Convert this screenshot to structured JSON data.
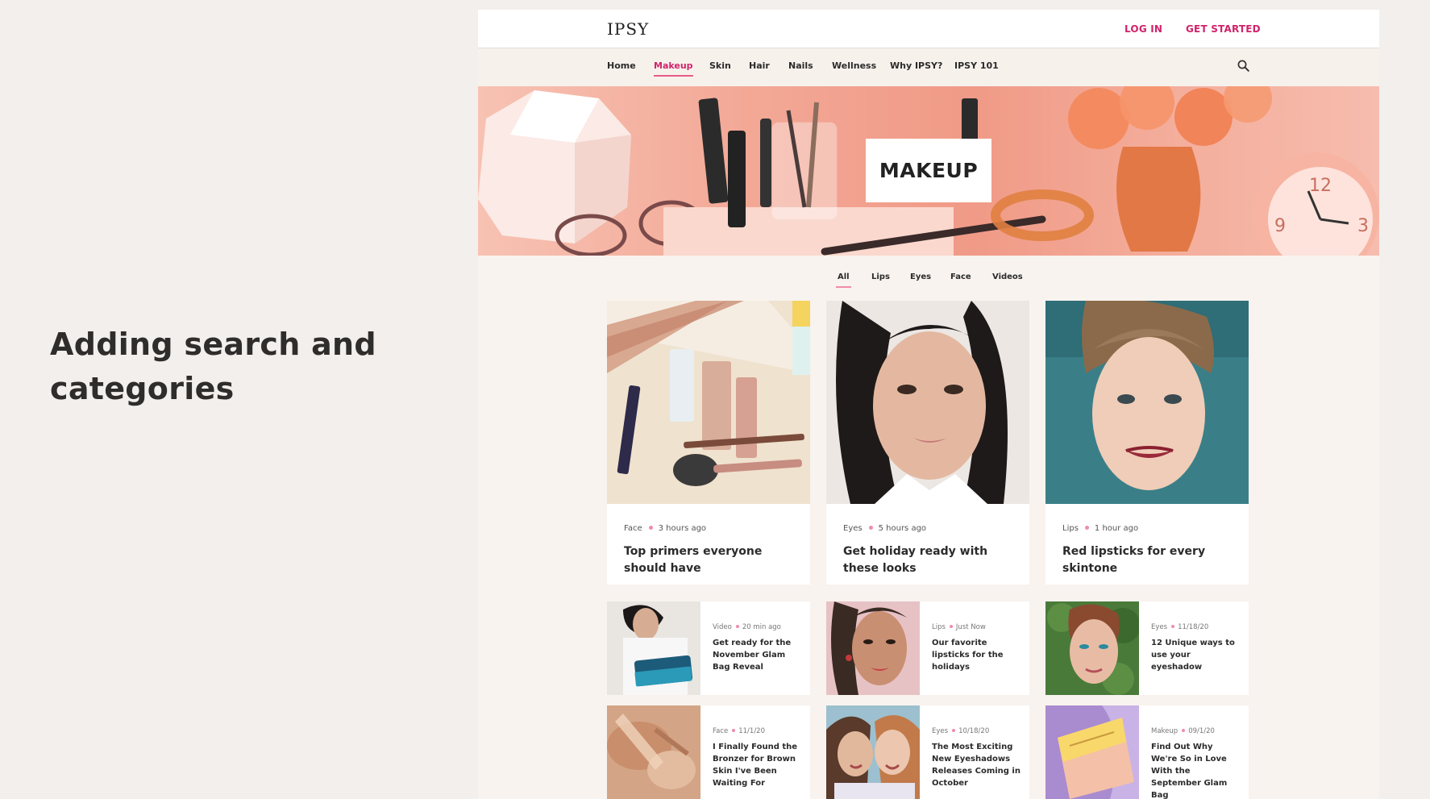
{
  "slide": {
    "title": "Adding search and categories"
  },
  "header": {
    "logo": "IPSY",
    "login": "LOG IN",
    "get_started": "GET STARTED"
  },
  "nav": {
    "items": [
      "Home",
      "Makeup",
      "Skin",
      "Hair",
      "Nails",
      "Wellness",
      "Why IPSY?",
      "IPSY 101"
    ],
    "active": "Makeup",
    "search_icon": "search-icon"
  },
  "hero": {
    "label": "MAKEUP"
  },
  "tabs": {
    "items": [
      "All",
      "Lips",
      "Eyes",
      "Face",
      "Videos"
    ],
    "active": "All"
  },
  "featured": [
    {
      "category": "Face",
      "time": "3 hours ago",
      "title": "Top primers everyone should have"
    },
    {
      "category": "Eyes",
      "time": "5 hours ago",
      "title": "Get holiday ready with these looks"
    },
    {
      "category": "Lips",
      "time": "1 hour ago",
      "title": "Red lipsticks for every skintone"
    }
  ],
  "articles": [
    {
      "category": "Video",
      "time": "20 min ago",
      "title": "Get ready for the November Glam Bag Reveal"
    },
    {
      "category": "Lips",
      "time": "Just Now",
      "title": "Our favorite lipsticks for the holidays"
    },
    {
      "category": "Eyes",
      "time": "11/18/20",
      "title": "12 Unique ways to use your eyeshadow"
    },
    {
      "category": "Face",
      "time": "11/1/20",
      "title": "I Finally Found the Bronzer for Brown Skin I've Been Waiting For"
    },
    {
      "category": "Eyes",
      "time": "10/18/20",
      "title": "The Most Exciting New Eyeshadows Releases Coming in October"
    },
    {
      "category": "Makeup",
      "time": "09/1/20",
      "title": "Find Out Why We're So in Love With the September Glam Bag"
    }
  ],
  "colors": {
    "accent": "#d0236b",
    "underline": "#f08ca8",
    "background": "#f8f3ef"
  }
}
